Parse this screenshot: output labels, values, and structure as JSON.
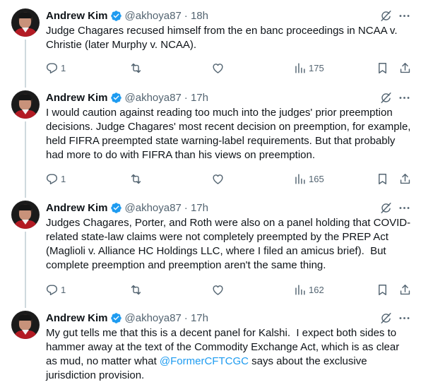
{
  "author": {
    "name": "Andrew Kim",
    "handle": "@akhoya87"
  },
  "colors": {
    "link": "#1d9bf0",
    "verified": "#1d9bf0",
    "secondary_text": "#536471",
    "thread_line": "#cfd9de"
  },
  "icons": {
    "reply": "reply-icon",
    "retweet": "retweet-icon",
    "like": "heart-icon",
    "views": "views-icon",
    "bookmark": "bookmark-icon",
    "share": "share-icon",
    "grok": "grok-icon",
    "more": "more-icon"
  },
  "tweets": [
    {
      "timestamp": "· 18h",
      "text": "Judge Chagares recused himself from the en banc proceedings in NCAA v. Christie (later Murphy v. NCAA).",
      "replies": "1",
      "views": "175"
    },
    {
      "timestamp": "· 17h",
      "text": "I would caution against reading too much into the judges' prior preemption decisions. Judge Chagares' most recent decision on preemption, for example, held FIFRA preempted state warning-label requirements. But that probably had more to do with FIFRA than his views on preemption.",
      "replies": "1",
      "views": "165"
    },
    {
      "timestamp": "· 17h",
      "text": "Judges Chagares, Porter, and Roth were also on a panel holding that COVID-related state-law claims were not completely preempted by the PREP Act (Maglioli v. Alliance HC Holdings LLC, where I filed an amicus brief).  But complete preemption and preemption aren't the same thing.",
      "replies": "1",
      "views": "162"
    },
    {
      "timestamp": "· 17h",
      "text_before": "My gut tells me that this is a decent panel for Kalshi.  I expect both sides to hammer away at the text of the Commodity Exchange Act, which is as clear as mud, no matter what ",
      "mention": "@FormerCFTCGC",
      "text_after": " says about the exclusive jurisdiction provision."
    }
  ]
}
